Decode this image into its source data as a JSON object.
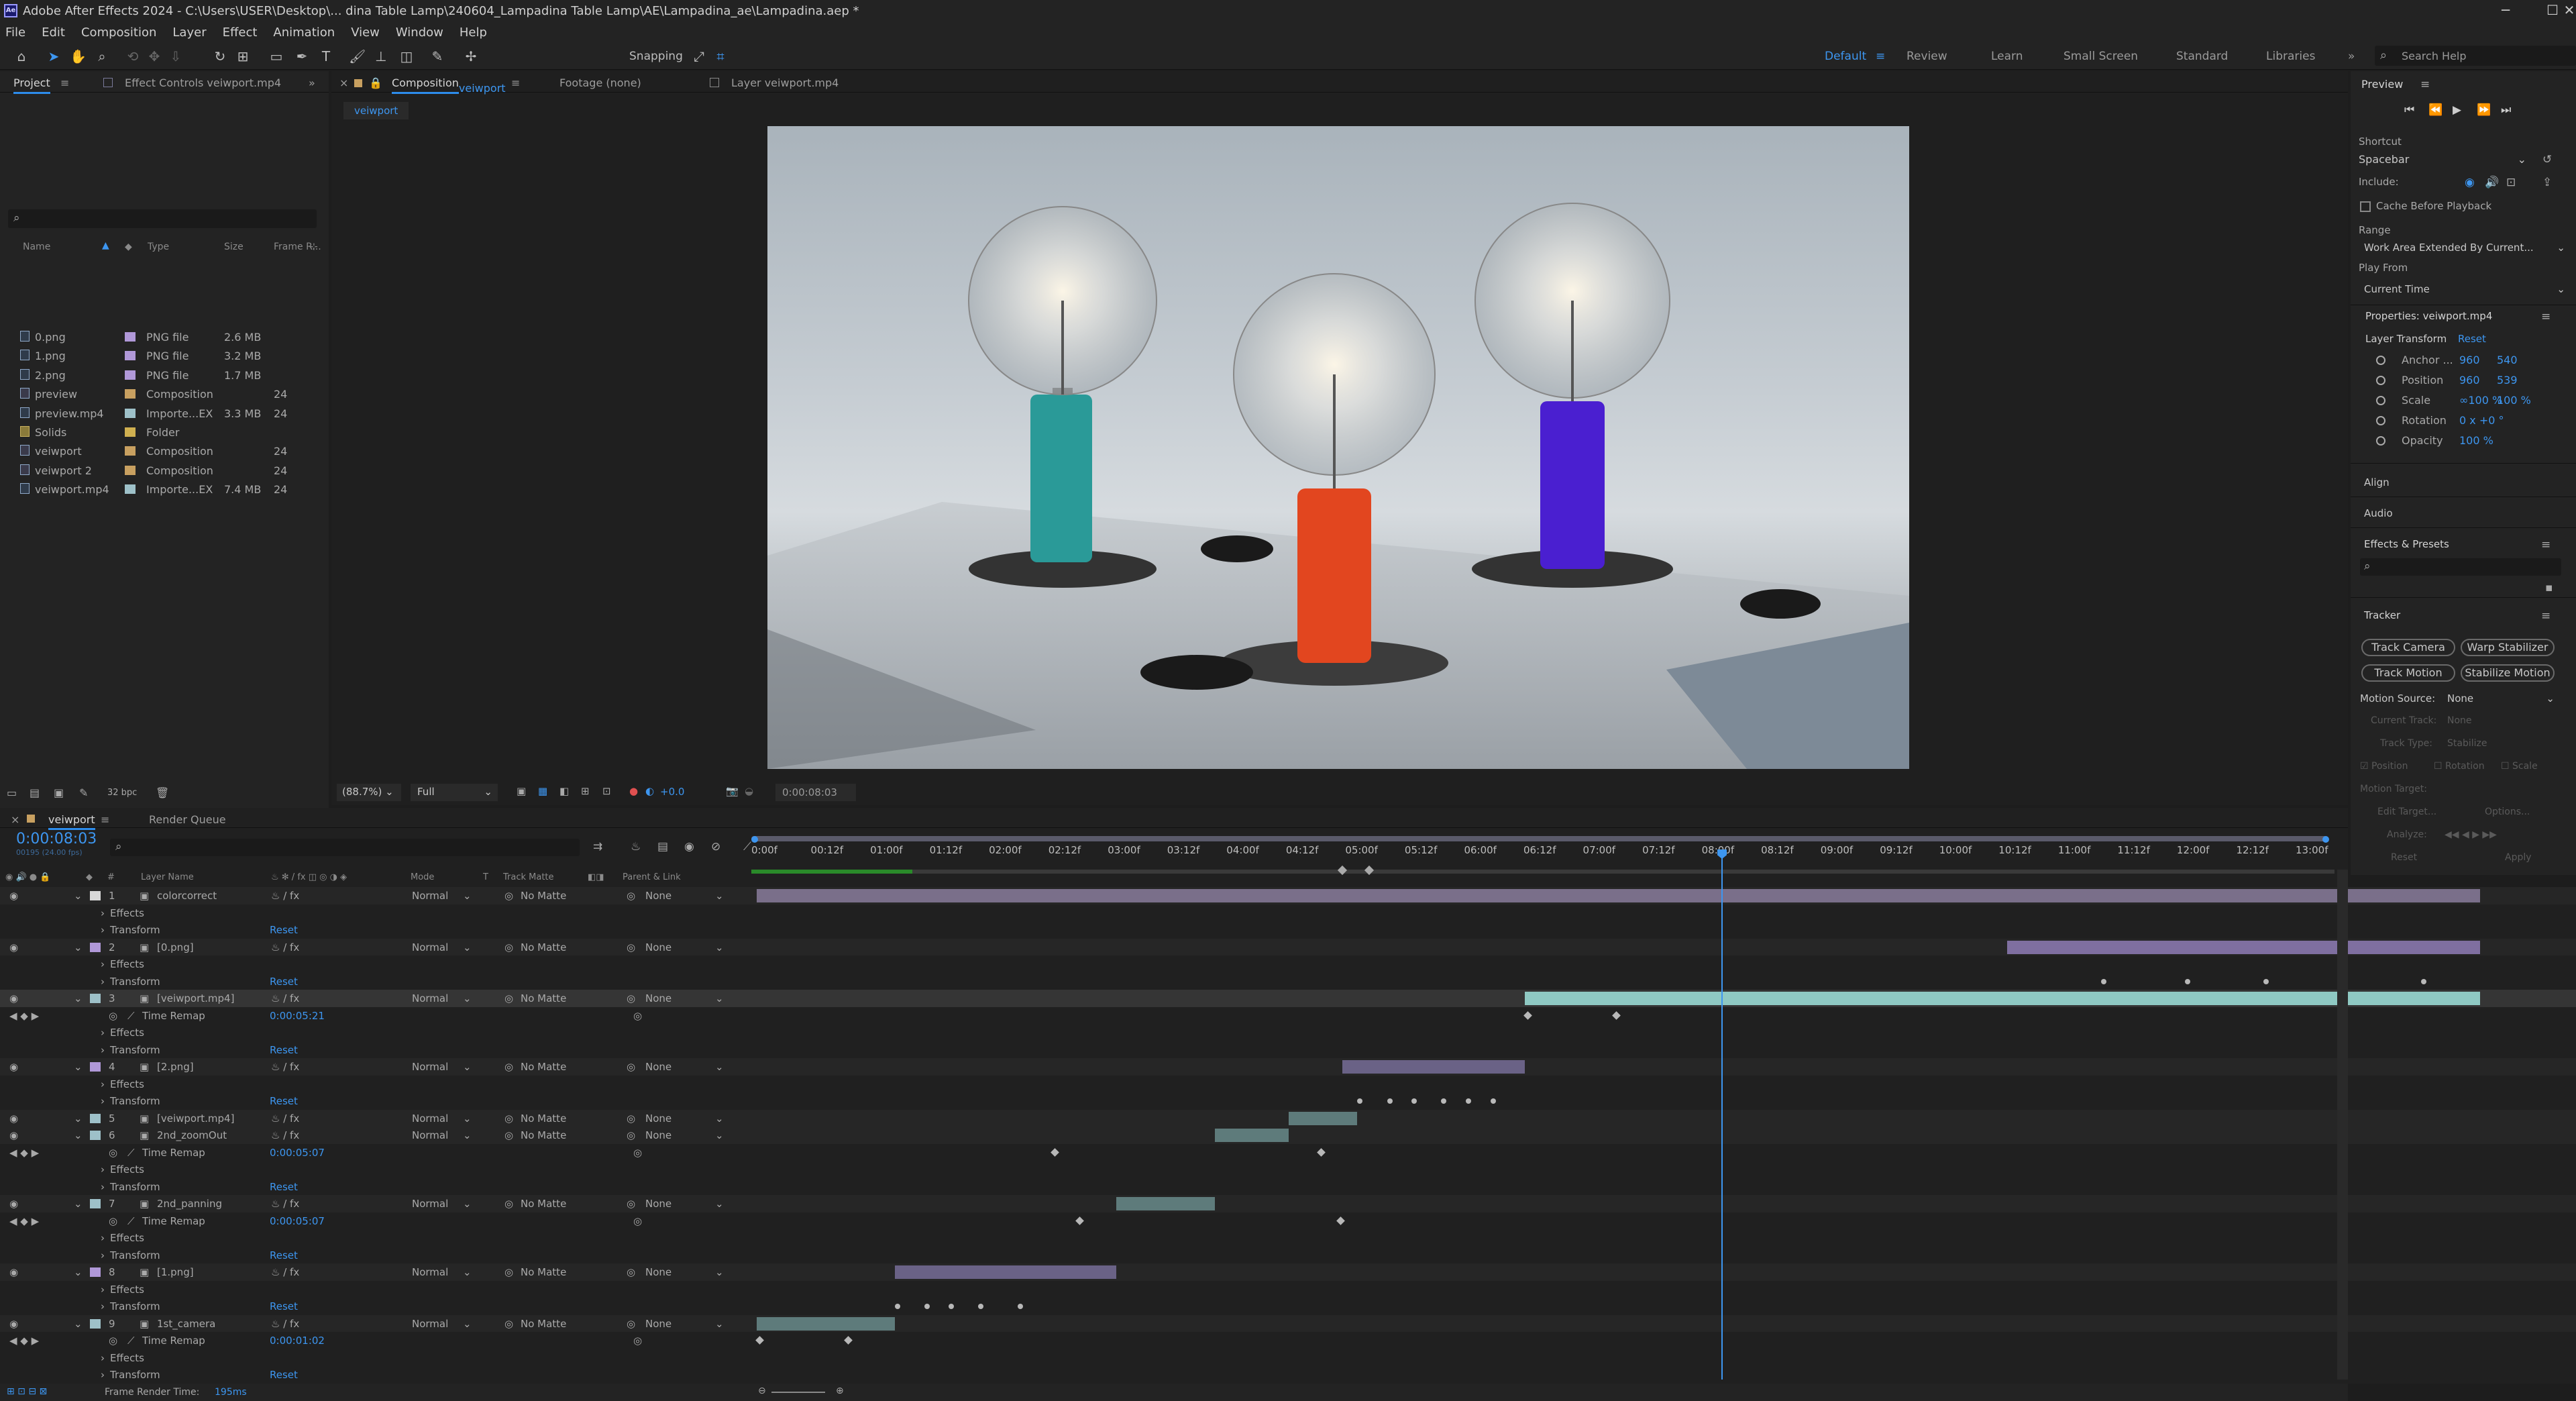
{
  "window": {
    "title": "Adobe After Effects 2024 - C:\\Users\\USER\\Desktop\\... dina Table Lamp\\240604_Lampadina Table Lamp\\AE\\Lampadina_ae\\Lampadina.aep *",
    "minimize": "─",
    "maximize": "☐",
    "close": "✕"
  },
  "menu": [
    "File",
    "Edit",
    "Composition",
    "Layer",
    "Effect",
    "Animation",
    "View",
    "Window",
    "Help"
  ],
  "toolbar": {
    "snapping": "Snapping",
    "workspaces": [
      "Default",
      "Review",
      "Learn",
      "Small Screen",
      "Standard",
      "Libraries"
    ],
    "active_workspace": "Default",
    "search_placeholder": "Search Help"
  },
  "project_panel": {
    "tabs": [
      "Project",
      "Effect Controls veiwport.mp4"
    ],
    "columns": [
      "Name",
      "Type",
      "Size",
      "Frame R..."
    ],
    "items": [
      {
        "name": "0.png",
        "type": "PNG file",
        "size": "2.6 MB",
        "fps": "",
        "color": "#b098d8",
        "kind": "file"
      },
      {
        "name": "1.png",
        "type": "PNG file",
        "size": "3.2 MB",
        "fps": "",
        "color": "#b098d8",
        "kind": "file"
      },
      {
        "name": "2.png",
        "type": "PNG file",
        "size": "1.7 MB",
        "fps": "",
        "color": "#b098d8",
        "kind": "file"
      },
      {
        "name": "preview",
        "type": "Composition",
        "size": "",
        "fps": "24",
        "color": "#c8a060",
        "kind": "comp"
      },
      {
        "name": "preview.mp4",
        "type": "Importe...EX",
        "size": "3.3 MB",
        "fps": "24",
        "color": "#9ec1c9",
        "kind": "file"
      },
      {
        "name": "Solids",
        "type": "Folder",
        "size": "",
        "fps": "",
        "color": "#d0b050",
        "kind": "folder"
      },
      {
        "name": "veiwport",
        "type": "Composition",
        "size": "",
        "fps": "24",
        "color": "#c8a060",
        "kind": "comp"
      },
      {
        "name": "veiwport 2",
        "type": "Composition",
        "size": "",
        "fps": "24",
        "color": "#c8a060",
        "kind": "comp"
      },
      {
        "name": "veiwport.mp4",
        "type": "Importe...EX",
        "size": "7.4 MB",
        "fps": "24",
        "color": "#9ec1c9",
        "kind": "file"
      }
    ],
    "bpc": "32 bpc"
  },
  "viewer": {
    "tabs": [
      "Composition veiwport",
      "Footage (none)",
      "Layer veiwport.mp4"
    ],
    "breadcrumb": "veiwport",
    "zoom": "(88.7%)",
    "resolution": "Full",
    "exposure": "+0.0",
    "timecode": "0:00:08:03"
  },
  "right_panel": {
    "preview_title": "Preview",
    "shortcut_label": "Shortcut",
    "shortcut_value": "Spacebar",
    "include_label": "Include:",
    "cache_label": "Cache Before Playback",
    "range_label": "Range",
    "range_value": "Work Area Extended By Current...",
    "playfrom_label": "Play From",
    "playfrom_value": "Current Time",
    "properties_title": "Properties: veiwport.mp4",
    "layer_transform": "Layer Transform",
    "reset": "Reset",
    "props": [
      {
        "label": "Anchor ...",
        "v1": "960",
        "v2": "540"
      },
      {
        "label": "Position",
        "v1": "960",
        "v2": "539"
      },
      {
        "label": "Scale",
        "v1": "∞100 %",
        "v2": "100 %"
      },
      {
        "label": "Rotation",
        "v1": "0 x +0 °",
        "v2": ""
      },
      {
        "label": "Opacity",
        "v1": "100 %",
        "v2": ""
      }
    ],
    "align": "Align",
    "audio": "Audio",
    "effects_presets": "Effects & Presets",
    "tracker": "Tracker",
    "tracker_buttons": [
      "Track Camera",
      "Warp Stabilizer",
      "Track Motion",
      "Stabilize Motion"
    ],
    "motion_source_label": "Motion Source:",
    "motion_source_value": "None",
    "current_track_label": "Current Track:",
    "current_track_value": "None",
    "track_type_label": "Track Type:",
    "track_type_value": "Stabilize",
    "checks": [
      "Position",
      "Rotation",
      "Scale"
    ],
    "motion_target": "Motion Target:",
    "edit_target": "Edit Target...",
    "options": "Options...",
    "analyze": "Analyze:",
    "reset_btn": "Reset",
    "apply_btn": "Apply"
  },
  "timeline": {
    "tabs": [
      "veiwport",
      "Render Queue"
    ],
    "timecode": "0:00:08:03",
    "fps_info": "00195 (24.00 fps)",
    "columns": [
      "#",
      "Layer Name",
      "Mode",
      "T",
      "Track Matte",
      "Parent & Link"
    ],
    "ruler": [
      "0:00f",
      "00:12f",
      "01:00f",
      "01:12f",
      "02:00f",
      "02:12f",
      "03:00f",
      "03:12f",
      "04:00f",
      "04:12f",
      "05:00f",
      "05:12f",
      "06:00f",
      "06:12f",
      "07:00f",
      "07:12f",
      "08:00f",
      "08:12f",
      "09:00f",
      "09:12f",
      "10:00f",
      "10:12f",
      "11:00f",
      "11:12f",
      "12:00f",
      "12:12f",
      "13:00f"
    ],
    "mode_normal": "Normal",
    "matte_none": "No Matte",
    "parent_none": "None",
    "effects": "Effects",
    "transform": "Transform",
    "reset": "Reset",
    "time_remap": "Time Remap",
    "layers": [
      {
        "num": "1",
        "name": "colorcorrect",
        "color": "#d8d8d8"
      },
      {
        "num": "2",
        "name": "[0.png]",
        "color": "#b098d8"
      },
      {
        "num": "3",
        "name": "[veiwport.mp4]",
        "color": "#9ec1c9",
        "remap": "0:00:05:21"
      },
      {
        "num": "4",
        "name": "[2.png]",
        "color": "#b098d8"
      },
      {
        "num": "5",
        "name": "[veiwport.mp4]",
        "color": "#9ec1c9"
      },
      {
        "num": "6",
        "name": "2nd_zoomOut",
        "color": "#9ec1c9",
        "remap": "0:00:05:07"
      },
      {
        "num": "7",
        "name": "2nd_panning",
        "color": "#9ec1c9",
        "remap": "0:00:05:07"
      },
      {
        "num": "8",
        "name": "[1.png]",
        "color": "#b098d8"
      },
      {
        "num": "9",
        "name": "1st_camera",
        "color": "#9ec1c9",
        "remap": "0:00:01:02"
      }
    ],
    "frame_render_label": "Frame Render Time:",
    "frame_render_value": "195ms"
  }
}
